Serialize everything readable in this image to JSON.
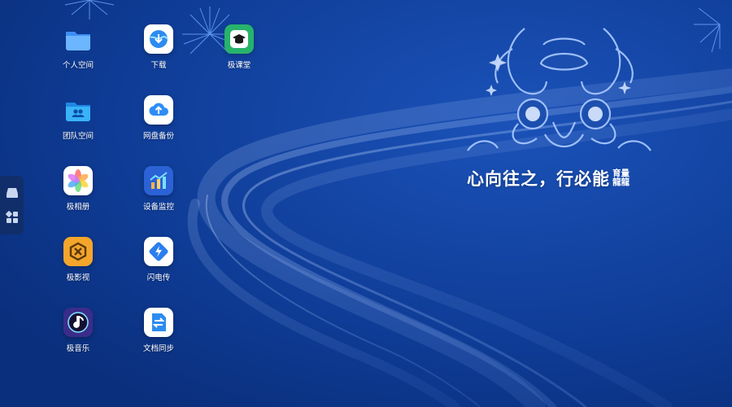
{
  "desktop": {
    "apps": [
      {
        "id": "personal-space",
        "label": "个人空间",
        "icon": "folder-icon",
        "color": "#4aa3ff"
      },
      {
        "id": "download",
        "label": "下载",
        "icon": "globe-download-icon",
        "color": "#2d8cf0"
      },
      {
        "id": "class",
        "label": "极课堂",
        "icon": "graduation-cap-icon",
        "color": "#27b36b"
      },
      {
        "id": "team-space",
        "label": "团队空间",
        "icon": "team-folder-icon",
        "color": "#35a7f0"
      },
      {
        "id": "cloud-backup",
        "label": "网盘备份",
        "icon": "cloud-upload-icon",
        "color": "#2f8df5"
      },
      {
        "id": "photos",
        "label": "极相册",
        "icon": "photos-flower-icon",
        "color": "#ffffff"
      },
      {
        "id": "monitor",
        "label": "设备监控",
        "icon": "chart-monitor-icon",
        "color": "#2b62d6"
      },
      {
        "id": "video",
        "label": "极影视",
        "icon": "video-icon",
        "color": "#f4a52c"
      },
      {
        "id": "flash-transfer",
        "label": "闪电传",
        "icon": "lightning-icon",
        "color": "#2b7ef0"
      },
      {
        "id": "music",
        "label": "极音乐",
        "icon": "music-note-icon",
        "color": "#3b2c8a"
      },
      {
        "id": "file-sync",
        "label": "文档同步",
        "icon": "sync-arrows-icon",
        "color": "#2d8cf0"
      }
    ]
  },
  "sidebar": {
    "items": [
      {
        "name": "drive-icon"
      },
      {
        "name": "apps-grid-icon"
      }
    ]
  },
  "wallpaper": {
    "slogan": "心向往之，行必能",
    "slogan_stack": [
      "育量",
      "龍龍"
    ],
    "colors": {
      "background": "#0e3b95",
      "accent": "#9fc3ff"
    }
  }
}
